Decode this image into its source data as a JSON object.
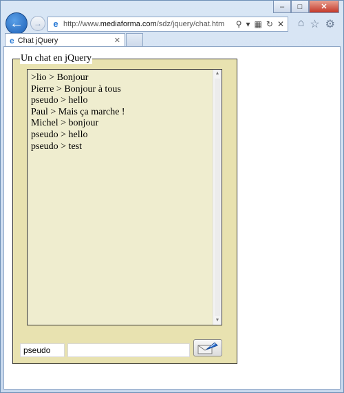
{
  "browser": {
    "url_prefix": "http://www.",
    "url_domain": "mediaforma.com",
    "url_path": "/sdz/jquery/chat.htm",
    "tab_title": "Chat jQuery"
  },
  "chat": {
    "legend": "Un chat en jQuery",
    "messages": [
      ">lio > Bonjour",
      "Pierre > Bonjour à tous",
      "pseudo > hello",
      "Paul > Mais ça marche !",
      "Michel > bonjour",
      "pseudo > hello",
      "pseudo > test"
    ],
    "pseudo_value": "pseudo",
    "message_value": ""
  }
}
